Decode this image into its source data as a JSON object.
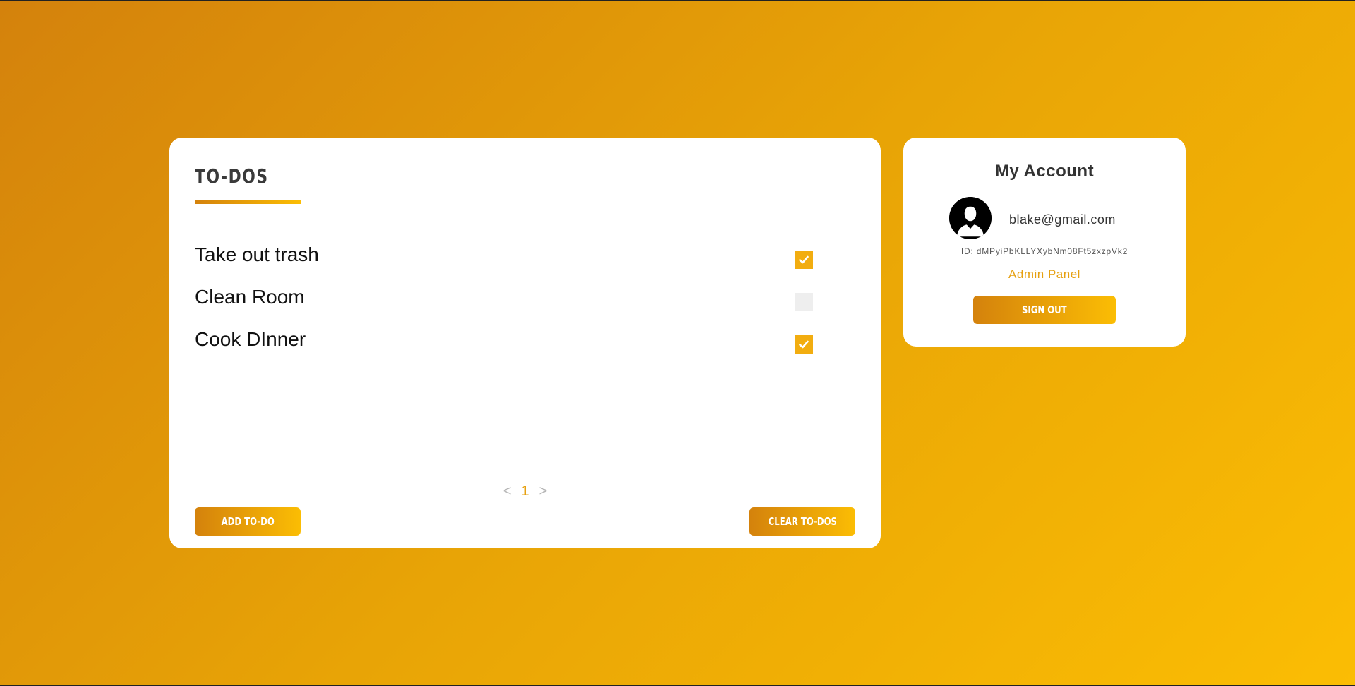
{
  "todos": {
    "title": "TO-DOS",
    "items": [
      {
        "text": "Take out trash",
        "checked": true
      },
      {
        "text": "Clean Room",
        "checked": false
      },
      {
        "text": "Cook DInner",
        "checked": true
      }
    ],
    "pagination": {
      "prev": "<",
      "page": "1",
      "next": ">"
    },
    "add_label": "ADD TO-DO",
    "clear_label": "CLEAR TO-DOS"
  },
  "account": {
    "title": "My Account",
    "email": "blake@gmail.com",
    "id_text": "ID: dMPyiPbKLLYXybNm08Ft5zxzpVk2",
    "admin_link": "Admin Panel",
    "signout_label": "SIGN OUT",
    "avatar_icon": "user-avatar-icon"
  },
  "colors": {
    "accent": "#f2ad10",
    "gradient_start": "#d4820c",
    "gradient_end": "#fbbd04"
  }
}
